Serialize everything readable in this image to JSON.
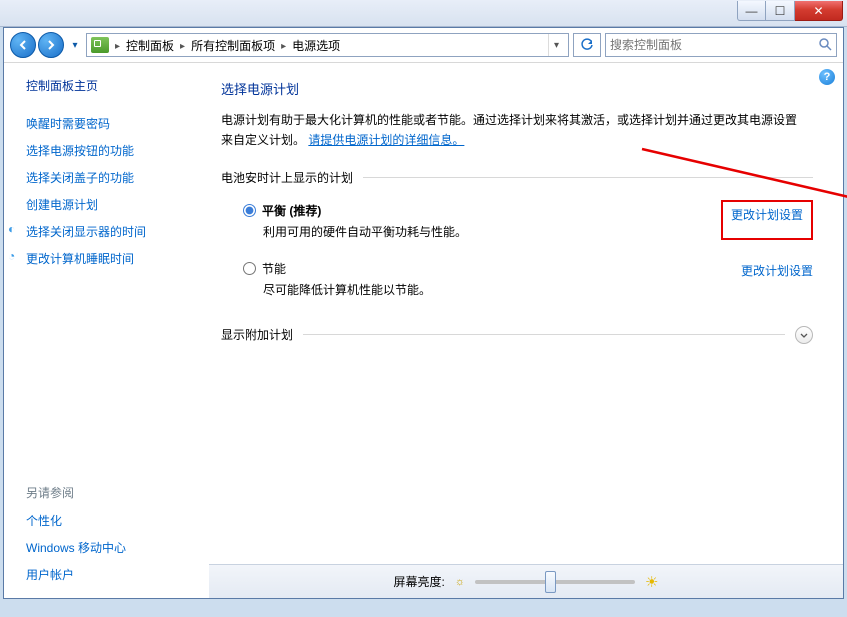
{
  "window_buttons": {
    "min": "—",
    "max": "☐",
    "close": "✕"
  },
  "breadcrumb": {
    "level1": "控制面板",
    "level2": "所有控制面板项",
    "level3": "电源选项"
  },
  "search": {
    "placeholder": "搜索控制面板"
  },
  "sidebar": {
    "home": "控制面板主页",
    "links": [
      "唤醒时需要密码",
      "选择电源按钮的功能",
      "选择关闭盖子的功能",
      "创建电源计划",
      "选择关闭显示器的时间",
      "更改计算机睡眠时间"
    ],
    "seealso_hdr": "另请参阅",
    "seealso": [
      "个性化",
      "Windows 移动中心",
      "用户帐户"
    ]
  },
  "main": {
    "title": "选择电源计划",
    "desc_part1": "电源计划有助于最大化计算机的性能或者节能。通过选择计划来将其激活，或选择计划并通过更改其电源设置来自定义计划。",
    "desc_link": "请提供电源计划的详细信息。",
    "group_label": "电池安时计上显示的计划",
    "plan1": {
      "name": "平衡 (推荐)",
      "desc": "利用可用的硬件自动平衡功耗与性能。",
      "change": "更改计划设置"
    },
    "plan2": {
      "name": "节能",
      "desc": "尽可能降低计算机性能以节能。",
      "change": "更改计划设置"
    },
    "expand_label": "显示附加计划",
    "brightness_label": "屏幕亮度:"
  }
}
